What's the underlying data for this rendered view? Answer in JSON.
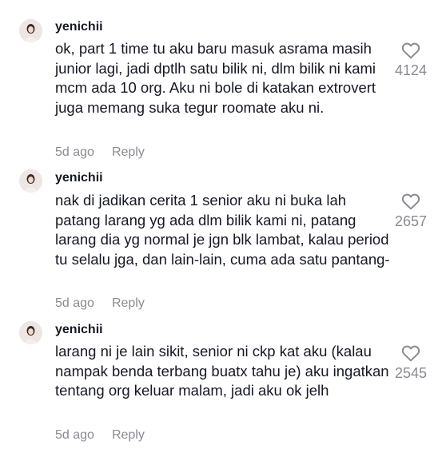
{
  "comments": [
    {
      "username": "yenichii",
      "text": "ok, part 1 time tu aku baru masuk asrama masih junior lagi, jadi dptlh satu bilik ni, dlm bilik ni kami mcm ada 10 org. Aku ni bole di katakan extrovert juga memang suka tegur roomate aku ni.",
      "time": "5d ago",
      "reply_label": "Reply",
      "likes": "4124",
      "like_icon": "heart-outline-icon"
    },
    {
      "username": "yenichii",
      "text": "nak di jadikan cerita 1 senior aku ni buka lah patang larang yg ada dlm bilik kami ni, patang larang dia yg normal je jgn blk lambat, kalau period tu selalu jga, dan lain-lain, cuma ada satu pantang-",
      "time": "5d ago",
      "reply_label": "Reply",
      "likes": "2657",
      "like_icon": "heart-outline-icon"
    },
    {
      "username": "yenichii",
      "text": "larang ni je lain sikit, senior ni ckp kat aku (kalau nampak benda terbang buatx tahu je) aku ingatkan tentang org keluar malam, jadi aku ok jelh",
      "time": "5d ago",
      "reply_label": "Reply",
      "likes": "2545",
      "like_icon": "heart-outline-icon"
    }
  ],
  "colors": {
    "text": "#161823",
    "muted": "#8a8b91",
    "background": "#ffffff"
  }
}
